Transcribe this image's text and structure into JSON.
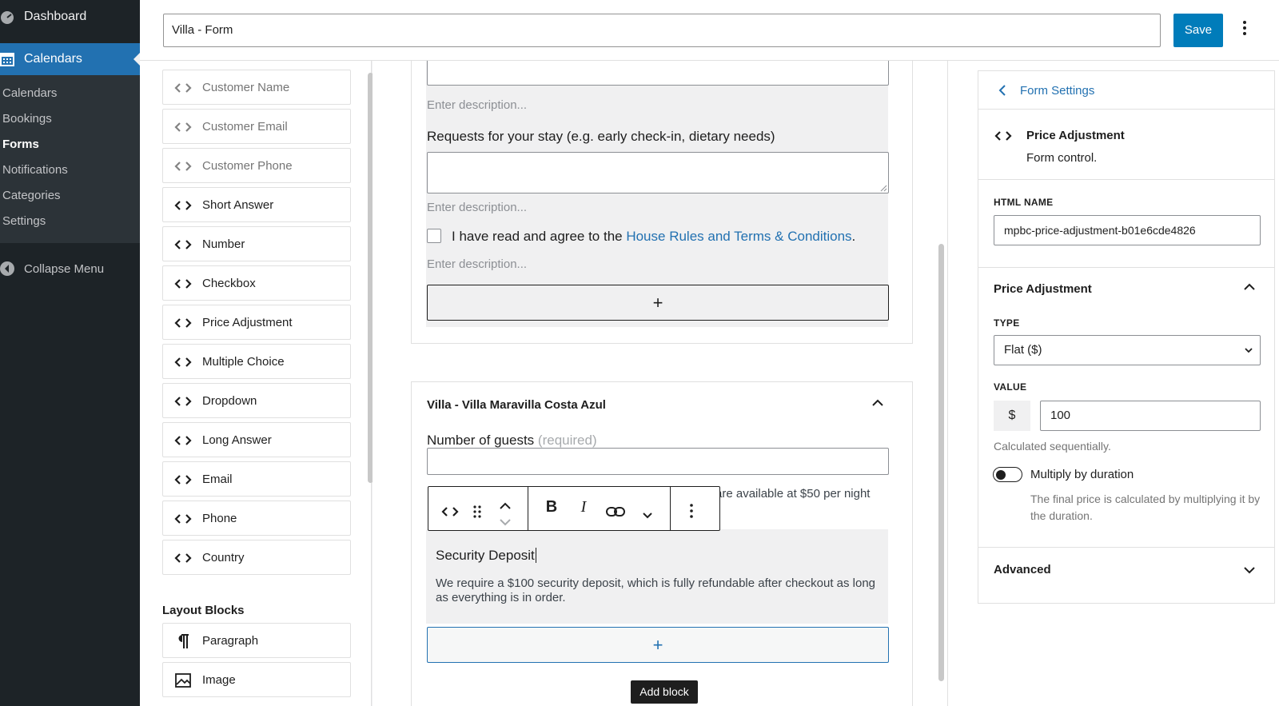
{
  "sidebar": {
    "dashboard": "Dashboard",
    "calendars": "Calendars",
    "submenu": [
      "Calendars",
      "Bookings",
      "Forms",
      "Notifications",
      "Categories",
      "Settings"
    ],
    "current": "Forms",
    "collapse": "Collapse Menu"
  },
  "header": {
    "title_value": "Villa - Form",
    "save_label": "Save"
  },
  "library": {
    "items": [
      {
        "label": "Customer Name",
        "disabled": true
      },
      {
        "label": "Customer Email",
        "disabled": true
      },
      {
        "label": "Customer Phone",
        "disabled": true
      },
      {
        "label": "Short Answer",
        "disabled": false
      },
      {
        "label": "Number",
        "disabled": false
      },
      {
        "label": "Checkbox",
        "disabled": false
      },
      {
        "label": "Price Adjustment",
        "disabled": false
      },
      {
        "label": "Multiple Choice",
        "disabled": false
      },
      {
        "label": "Dropdown",
        "disabled": false
      },
      {
        "label": "Long Answer",
        "disabled": false
      },
      {
        "label": "Email",
        "disabled": false
      },
      {
        "label": "Phone",
        "disabled": false
      },
      {
        "label": "Country",
        "disabled": false
      }
    ],
    "layout_heading": "Layout Blocks",
    "layout_items": [
      {
        "label": "Paragraph",
        "icon": "paragraph-icon"
      },
      {
        "label": "Image",
        "icon": "image-icon"
      }
    ]
  },
  "canvas": {
    "desc_placeholder": "Enter description...",
    "requests_label": "Requests for your stay (e.g. early check-in, dietary needs)",
    "agree_text_before": "I have read and agree to the ",
    "agree_link": "House Rules and Terms & Conditions",
    "agree_text_after": ".",
    "add_symbol": "+",
    "section_title": "Villa - Villa Maravilla Costa Azul",
    "guests_label": "Number of guests",
    "guests_required": "(required)",
    "guests_note_partial": "are available at $50 per night",
    "deposit_title": "Security Deposit",
    "deposit_desc": "We require a $100 security deposit, which is fully refundable after checkout as long as everything is in order.",
    "tooltip": "Add block"
  },
  "toolbar": {
    "bold": "B",
    "italic": "I"
  },
  "settings": {
    "back_label": "Form Settings",
    "block_title": "Price Adjustment",
    "block_desc": "Form control.",
    "html_name_label": "HTML NAME",
    "html_name_value": "mpbc-price-adjustment-b01e6cde4826",
    "section_title": "Price Adjustment",
    "type_label": "TYPE",
    "type_value": "Flat ($)",
    "value_label": "VALUE",
    "currency_symbol": "$",
    "value": "100",
    "calc_note": "Calculated sequentially.",
    "multiply_label": "Multiply by duration",
    "multiply_on": false,
    "multiply_help": "The final price is calculated by multiplying it by the duration.",
    "advanced_label": "Advanced"
  },
  "colors": {
    "accent": "#2271b1",
    "sidebar_bg": "#1d2327",
    "link": "#2271b1"
  }
}
